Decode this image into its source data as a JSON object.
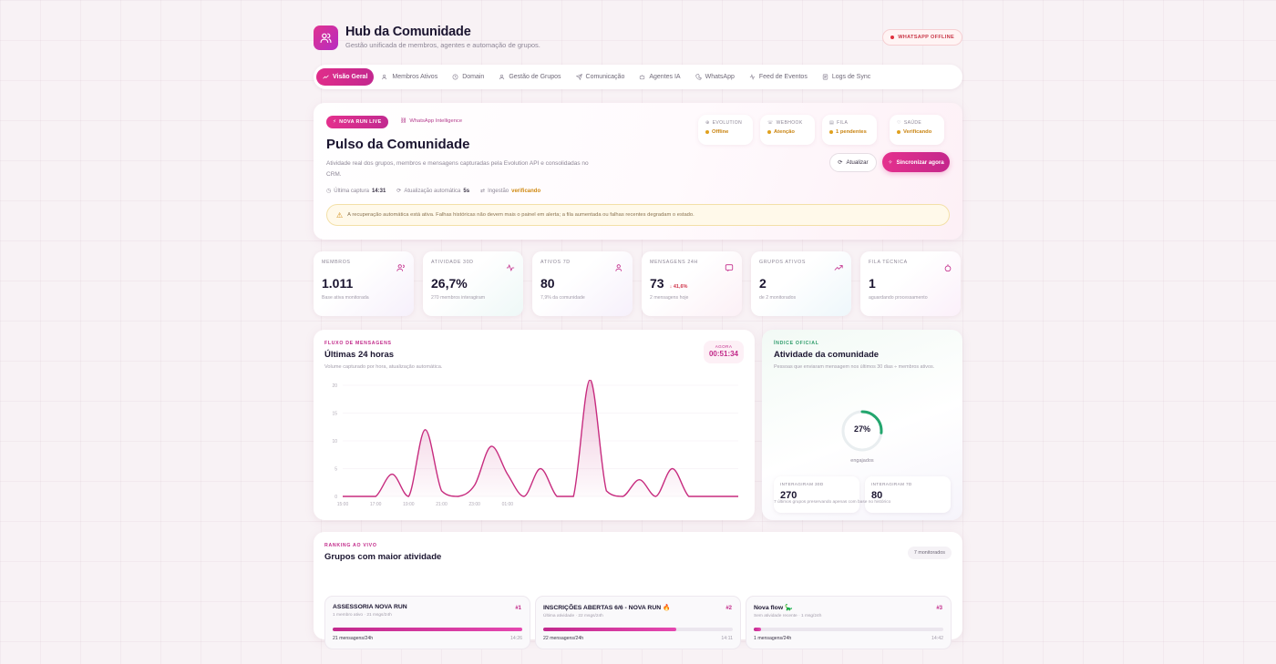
{
  "header": {
    "title": "Hub da Comunidade",
    "subtitle": "Gestão unificada de membros, agentes e automação de grupos.",
    "status_badge": "WHATSAPP OFFLINE"
  },
  "nav": {
    "tabs": [
      {
        "label": "Visão Geral",
        "icon": "trend-icon",
        "active": true
      },
      {
        "label": "Membros Ativos",
        "icon": "users-icon",
        "active": false
      },
      {
        "label": "Domain",
        "icon": "clock-icon",
        "active": false
      },
      {
        "label": "Gestão de Grupos",
        "icon": "user-icon",
        "active": false
      },
      {
        "label": "Comunicação",
        "icon": "send-icon",
        "active": false
      },
      {
        "label": "Agentes IA",
        "icon": "bot-icon",
        "active": false
      },
      {
        "label": "WhatsApp",
        "icon": "phone-icon",
        "active": false
      },
      {
        "label": "Feed de Eventos",
        "icon": "feed-icon",
        "active": false
      },
      {
        "label": "Logs de Sync",
        "icon": "log-icon",
        "active": false
      }
    ]
  },
  "hero": {
    "pill_run": "NOVA RUN LIVE",
    "pill_intel": "WhatsApp Intelligence",
    "title": "Pulso da Comunidade",
    "description": "Atividade real dos grupos, membros e mensagens capturadas pela Evolution API e consolidadas no CRM.",
    "meta": {
      "last_capture_label": "Última captura",
      "last_capture_value": "14:31",
      "auto_update_label": "Atualização automática",
      "auto_update_value": "5s",
      "ingestion_label": "Ingestão",
      "ingestion_value": "verificando"
    },
    "alert": "A recuperação automática está ativa. Falhas históricas não devem mais o painel em alerta; a fila aumentada ou falhas recentes degradam o estado.",
    "status_cards": [
      {
        "label": "EVOLUTION",
        "value": "Offline",
        "icon": "plug-icon"
      },
      {
        "label": "WEBHOOK",
        "value": "Atenção",
        "icon": "phone-icon"
      },
      {
        "label": "FILA",
        "value": "1 pendentes",
        "icon": "list-icon"
      },
      {
        "label": "SAÚDE",
        "value": "Verificando",
        "icon": "heart-icon"
      }
    ],
    "btn_update": "Atualizar",
    "btn_sync": "Sincronizar agora"
  },
  "metrics": [
    {
      "label": "MEMBROS",
      "value": "1.011",
      "delta": "",
      "sub": "Base ativa monitorada",
      "icon": "users-icon",
      "tint": "#f6f0fb"
    },
    {
      "label": "ATIVIDADE 30D",
      "value": "26,7%",
      "delta": "",
      "sub": "270 membros interagiram",
      "icon": "pulse-icon",
      "tint": "#eef8f7"
    },
    {
      "label": "ATIVOS 7D",
      "value": "80",
      "delta": "",
      "sub": "7,9% da comunidade",
      "icon": "user-check-icon",
      "tint": "#f6f0fb"
    },
    {
      "label": "MENSAGENS 24H",
      "value": "73",
      "delta": "↓ 41,6%",
      "sub": "2 mensagens hoje",
      "icon": "message-icon",
      "tint": "#fcf0f6"
    },
    {
      "label": "GRUPOS ATIVOS",
      "value": "2",
      "delta": "",
      "sub": "de 2 monitorados",
      "icon": "trend-icon",
      "tint": "#eef7fb"
    },
    {
      "label": "FILA TÉCNICA",
      "value": "1",
      "delta": "",
      "sub": "aguardando processamento",
      "icon": "queue-icon",
      "tint": "#fbf0fa"
    }
  ],
  "chart": {
    "eyebrow": "FLUXO DE MENSAGENS",
    "title": "Últimas 24 horas",
    "description": "Volume capturado por hora, atualização automática.",
    "now_label": "AGORA",
    "now_value": "00:51:34"
  },
  "chart_data": {
    "type": "area",
    "x": [
      "15:00",
      "16:00",
      "17:00",
      "18:00",
      "19:00",
      "20:00",
      "21:00",
      "22:00",
      "23:00",
      "00:00",
      "01:00",
      "02:00",
      "03:00",
      "04:00",
      "05:00",
      "06:00",
      "07:00",
      "08:00",
      "09:00",
      "10:00",
      "11:00",
      "12:00",
      "13:00",
      "14:00",
      "15:00"
    ],
    "xticks": [
      "15:00",
      "17:00",
      "19:00",
      "21:00",
      "23:00",
      "01:00"
    ],
    "y": [
      0,
      0,
      0,
      4,
      0,
      12,
      1,
      0,
      2,
      9,
      4,
      0,
      5,
      0,
      0,
      21,
      1,
      0,
      3,
      0,
      5,
      0,
      0,
      0,
      0
    ],
    "yticks": [
      "0",
      "5",
      "10",
      "15",
      "20"
    ],
    "ylim": [
      0,
      20
    ],
    "color": "#c72c7f",
    "grid": true
  },
  "activity": {
    "eyebrow": "ÍNDICE OFICIAL",
    "title": "Atividade da comunidade",
    "description": "Pessoas que enviaram mensagem nos últimos 30 dias ÷ membros ativos.",
    "gauge_value": "27%",
    "gauge_fraction": 0.267,
    "gauge_label": "engajados",
    "mini": [
      {
        "label": "INTERAGIRAM 30D",
        "value": "270"
      },
      {
        "label": "INTERAGIRAM 7D",
        "value": "80"
      }
    ],
    "footnote": "7 últimos grupos preservando apenas com base no histórico"
  },
  "ranking": {
    "eyebrow": "RANKING AO VIVO",
    "title": "Grupos com maior atividade",
    "badge": "7 monitorados",
    "groups": [
      {
        "name": "ASSESSORIA NOVA RUN",
        "meta": "1 membro ativo · 21 msgs/24h",
        "rank": "#1",
        "fill": 1.0,
        "messages": "21 mensagens/24h",
        "time": "14:26"
      },
      {
        "name": "INSCRIÇÕES ABERTAS 6/6 - NOVA RUN 🔥",
        "meta": "Última atividade · 22 msgs/24h",
        "rank": "#2",
        "fill": 0.7,
        "messages": "22 mensagens/24h",
        "time": "14:11"
      },
      {
        "name": "Nova flow 🦕",
        "meta": "Sem atividade recente · 1 msg/24h",
        "rank": "#3",
        "fill": 0.04,
        "messages": "1 mensagens/24h",
        "time": "14:42"
      }
    ]
  }
}
